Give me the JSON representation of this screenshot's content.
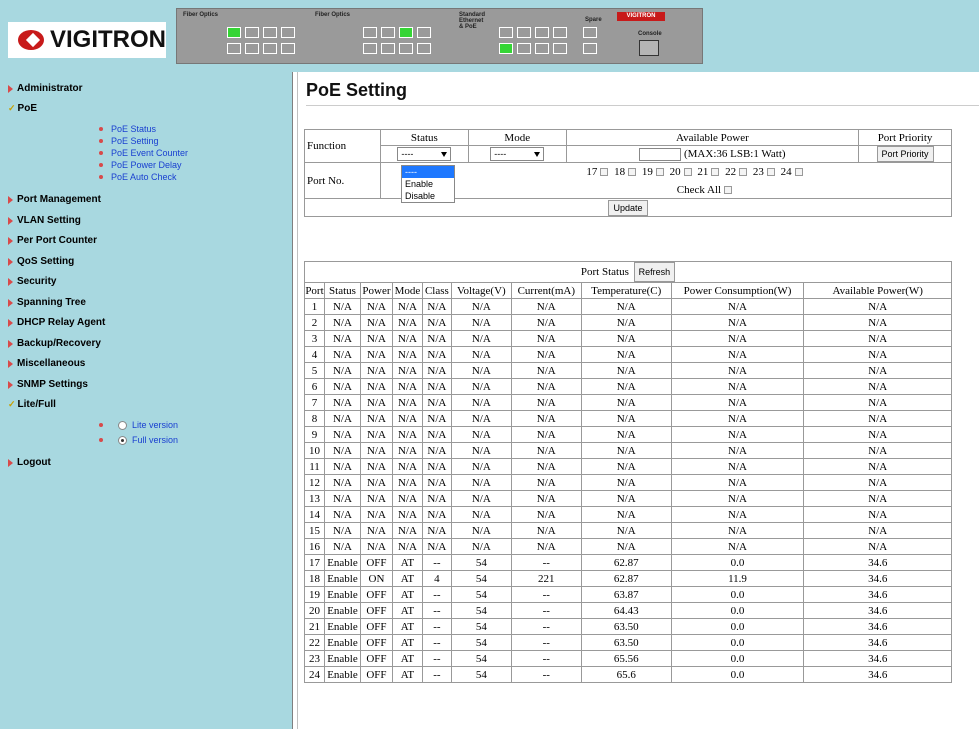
{
  "header": {
    "brand": "VIGITRON",
    "switch_panel": {
      "brand_label": "VIGITRON",
      "fiber_label_1": "Fiber Optics",
      "fiber_label_2": "Fiber Optics",
      "std_label": "Standard Ethernet & PoE",
      "spare_label": "Spare",
      "console_label": "Console"
    }
  },
  "sidebar": {
    "items": [
      {
        "label": "Administrator",
        "marker": "arrow"
      },
      {
        "label": "PoE",
        "marker": "check"
      },
      {
        "label": "Port Management",
        "marker": "arrow"
      },
      {
        "label": "VLAN Setting",
        "marker": "arrow"
      },
      {
        "label": "Per Port Counter",
        "marker": "arrow"
      },
      {
        "label": "QoS Setting",
        "marker": "arrow"
      },
      {
        "label": "Security",
        "marker": "arrow"
      },
      {
        "label": "Spanning Tree",
        "marker": "arrow"
      },
      {
        "label": "DHCP Relay Agent",
        "marker": "arrow"
      },
      {
        "label": "Backup/Recovery",
        "marker": "arrow"
      },
      {
        "label": "Miscellaneous",
        "marker": "arrow"
      },
      {
        "label": "SNMP Settings",
        "marker": "arrow"
      },
      {
        "label": "Lite/Full",
        "marker": "check"
      },
      {
        "label": "Logout",
        "marker": "arrow"
      }
    ],
    "poe_sub": [
      "PoE Status",
      "PoE Setting",
      "PoE Event Counter",
      "PoE Power Delay",
      "PoE Auto Check"
    ],
    "version": {
      "lite": "Lite version",
      "full": "Full version",
      "selected": "full"
    }
  },
  "main": {
    "title": "PoE Setting",
    "func": {
      "function_label": "Function",
      "status_header": "Status",
      "mode_header": "Mode",
      "power_header": "Available Power",
      "priority_header": "Port Priority",
      "status_value": "----",
      "mode_value": "----",
      "power_hint": "(MAX:36 LSB:1 Watt)",
      "priority_button": "Port Priority",
      "port_no_label": "Port No.",
      "ports": [
        "17",
        "18",
        "19",
        "20",
        "21",
        "22",
        "23",
        "24"
      ],
      "check_all": "Check All",
      "update_button": "Update",
      "status_options": [
        "----",
        "Enable",
        "Disable"
      ]
    },
    "port_status": {
      "title": "Port Status",
      "refresh_button": "Refresh",
      "columns": [
        "Port",
        "Status",
        "Power",
        "Mode",
        "Class",
        "Voltage(V)",
        "Current(mA)",
        "Temperature(C)",
        "Power Consumption(W)",
        "Available Power(W)"
      ],
      "rows": [
        [
          "1",
          "N/A",
          "N/A",
          "N/A",
          "N/A",
          "N/A",
          "N/A",
          "N/A",
          "N/A",
          "N/A"
        ],
        [
          "2",
          "N/A",
          "N/A",
          "N/A",
          "N/A",
          "N/A",
          "N/A",
          "N/A",
          "N/A",
          "N/A"
        ],
        [
          "3",
          "N/A",
          "N/A",
          "N/A",
          "N/A",
          "N/A",
          "N/A",
          "N/A",
          "N/A",
          "N/A"
        ],
        [
          "4",
          "N/A",
          "N/A",
          "N/A",
          "N/A",
          "N/A",
          "N/A",
          "N/A",
          "N/A",
          "N/A"
        ],
        [
          "5",
          "N/A",
          "N/A",
          "N/A",
          "N/A",
          "N/A",
          "N/A",
          "N/A",
          "N/A",
          "N/A"
        ],
        [
          "6",
          "N/A",
          "N/A",
          "N/A",
          "N/A",
          "N/A",
          "N/A",
          "N/A",
          "N/A",
          "N/A"
        ],
        [
          "7",
          "N/A",
          "N/A",
          "N/A",
          "N/A",
          "N/A",
          "N/A",
          "N/A",
          "N/A",
          "N/A"
        ],
        [
          "8",
          "N/A",
          "N/A",
          "N/A",
          "N/A",
          "N/A",
          "N/A",
          "N/A",
          "N/A",
          "N/A"
        ],
        [
          "9",
          "N/A",
          "N/A",
          "N/A",
          "N/A",
          "N/A",
          "N/A",
          "N/A",
          "N/A",
          "N/A"
        ],
        [
          "10",
          "N/A",
          "N/A",
          "N/A",
          "N/A",
          "N/A",
          "N/A",
          "N/A",
          "N/A",
          "N/A"
        ],
        [
          "11",
          "N/A",
          "N/A",
          "N/A",
          "N/A",
          "N/A",
          "N/A",
          "N/A",
          "N/A",
          "N/A"
        ],
        [
          "12",
          "N/A",
          "N/A",
          "N/A",
          "N/A",
          "N/A",
          "N/A",
          "N/A",
          "N/A",
          "N/A"
        ],
        [
          "13",
          "N/A",
          "N/A",
          "N/A",
          "N/A",
          "N/A",
          "N/A",
          "N/A",
          "N/A",
          "N/A"
        ],
        [
          "14",
          "N/A",
          "N/A",
          "N/A",
          "N/A",
          "N/A",
          "N/A",
          "N/A",
          "N/A",
          "N/A"
        ],
        [
          "15",
          "N/A",
          "N/A",
          "N/A",
          "N/A",
          "N/A",
          "N/A",
          "N/A",
          "N/A",
          "N/A"
        ],
        [
          "16",
          "N/A",
          "N/A",
          "N/A",
          "N/A",
          "N/A",
          "N/A",
          "N/A",
          "N/A",
          "N/A"
        ],
        [
          "17",
          "Enable",
          "OFF",
          "AT",
          "--",
          "54",
          "--",
          "62.87",
          "0.0",
          "34.6"
        ],
        [
          "18",
          "Enable",
          "ON",
          "AT",
          "4",
          "54",
          "221",
          "62.87",
          "11.9",
          "34.6"
        ],
        [
          "19",
          "Enable",
          "OFF",
          "AT",
          "--",
          "54",
          "--",
          "63.87",
          "0.0",
          "34.6"
        ],
        [
          "20",
          "Enable",
          "OFF",
          "AT",
          "--",
          "54",
          "--",
          "64.43",
          "0.0",
          "34.6"
        ],
        [
          "21",
          "Enable",
          "OFF",
          "AT",
          "--",
          "54",
          "--",
          "63.50",
          "0.0",
          "34.6"
        ],
        [
          "22",
          "Enable",
          "OFF",
          "AT",
          "--",
          "54",
          "--",
          "63.50",
          "0.0",
          "34.6"
        ],
        [
          "23",
          "Enable",
          "OFF",
          "AT",
          "--",
          "54",
          "--",
          "65.56",
          "0.0",
          "34.6"
        ],
        [
          "24",
          "Enable",
          "OFF",
          "AT",
          "--",
          "54",
          "--",
          "65.6",
          "0.0",
          "34.6"
        ]
      ]
    }
  },
  "colors": {
    "panel_bg": "#a8d8e0",
    "link": "#1a40d0",
    "marker": "#d84a4a",
    "highlight": "#1e78ff",
    "port_on": "#35d535",
    "brand_red": "#c81a1a"
  }
}
